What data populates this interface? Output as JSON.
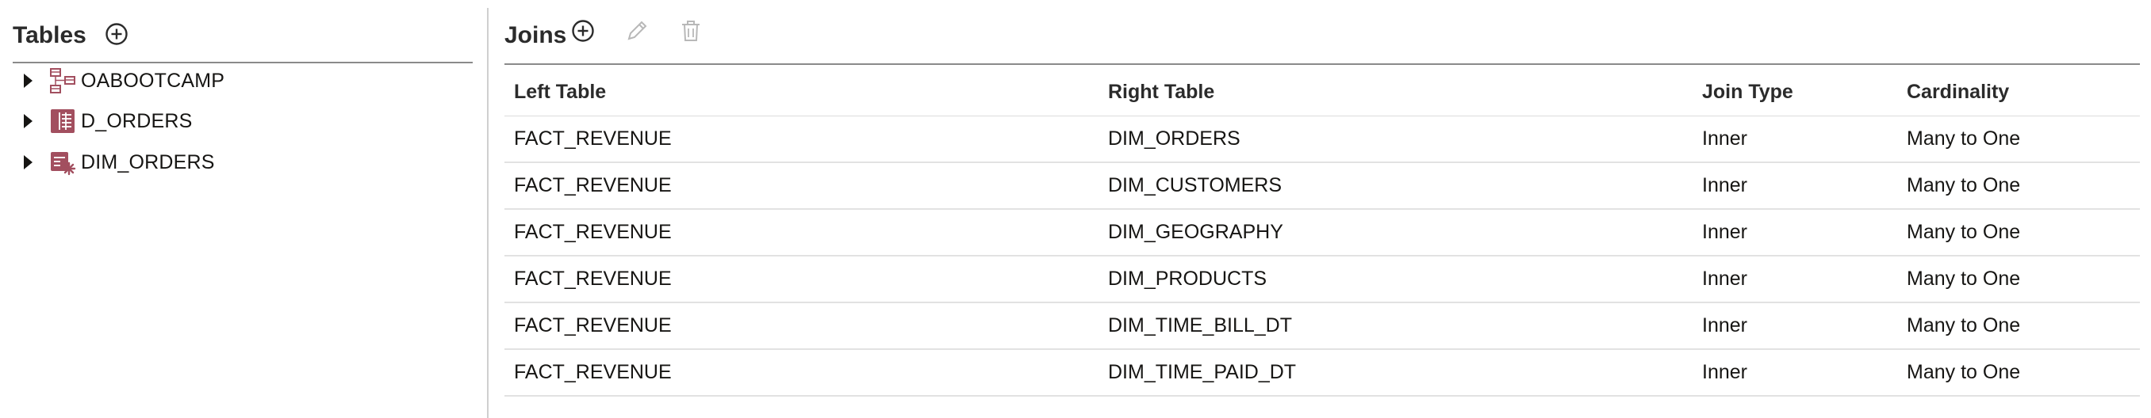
{
  "tables_panel": {
    "title": "Tables",
    "add_icon": "plus-circle-icon",
    "items": [
      {
        "label": "OABOOTCAMP",
        "icon": "schema-icon",
        "expanded": false
      },
      {
        "label": "D_ORDERS",
        "icon": "fact-table-icon",
        "expanded": false
      },
      {
        "label": "DIM_ORDERS",
        "icon": "dimension-table-icon",
        "expanded": false
      }
    ]
  },
  "joins_panel": {
    "title": "Joins",
    "toolbar": {
      "add_icon": "plus-circle-icon",
      "edit_icon": "pencil-icon",
      "delete_icon": "trash-icon",
      "edit_enabled": false,
      "delete_enabled": false
    },
    "columns": [
      "Left Table",
      "Right Table",
      "Join Type",
      "Cardinality"
    ],
    "rows": [
      [
        "FACT_REVENUE",
        "DIM_ORDERS",
        "Inner",
        "Many to One"
      ],
      [
        "FACT_REVENUE",
        "DIM_CUSTOMERS",
        "Inner",
        "Many to One"
      ],
      [
        "FACT_REVENUE",
        "DIM_GEOGRAPHY",
        "Inner",
        "Many to One"
      ],
      [
        "FACT_REVENUE",
        "DIM_PRODUCTS",
        "Inner",
        "Many to One"
      ],
      [
        "FACT_REVENUE",
        "DIM_TIME_BILL_DT",
        "Inner",
        "Many to One"
      ],
      [
        "FACT_REVENUE",
        "DIM_TIME_PAID_DT",
        "Inner",
        "Many to One"
      ]
    ]
  },
  "colors": {
    "icon_brand": "#a24f5f",
    "header_rule": "#8a8a8a",
    "disabled_icon": "#b8b8b8"
  }
}
